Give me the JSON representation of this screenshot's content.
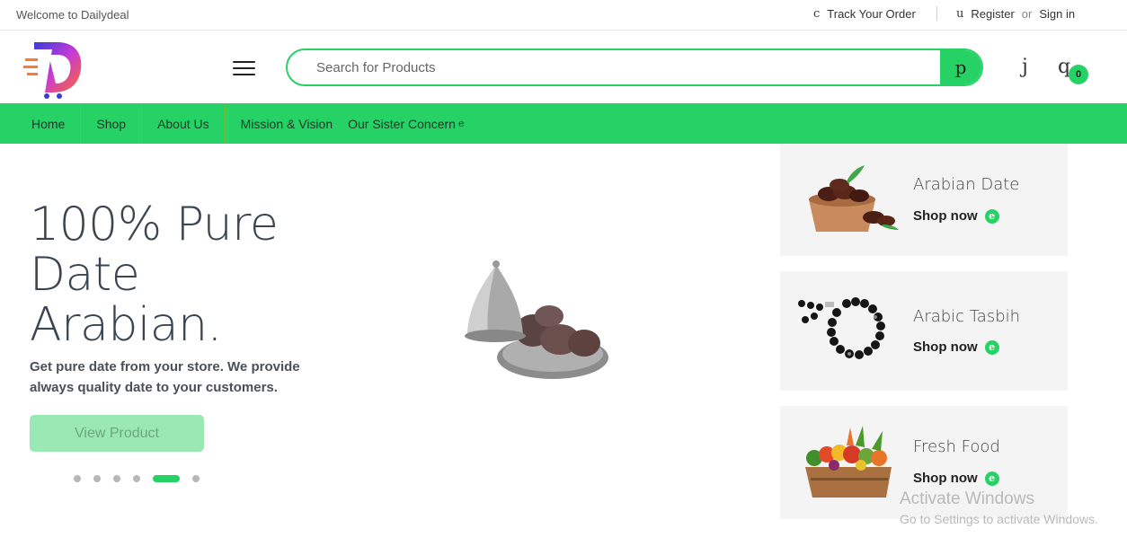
{
  "topbar": {
    "welcome": "Welcome to Dailydeal",
    "track_icon": "c",
    "track_label": "Track Your Order",
    "account_icon": "u",
    "register_label": "Register",
    "or_label": "or",
    "signin_label": "Sign in"
  },
  "header": {
    "search_placeholder": "Search for Products",
    "search_icon": "p",
    "wishlist_icon": "j",
    "cart_icon": "q",
    "cart_count": "0"
  },
  "nav": {
    "items": [
      {
        "label": "Home"
      },
      {
        "label": "Shop"
      },
      {
        "label": "About Us"
      },
      {
        "label": "Mission & Vision"
      },
      {
        "label": "Our Sister Concern",
        "arrow": "e"
      }
    ]
  },
  "hero": {
    "title_lines": [
      "100% Pure",
      "Date",
      "Arabian."
    ],
    "description": "Get pure date from your store. We provide always quality date to your customers.",
    "button_label": "View Product",
    "slides_total": 6,
    "active_slide": 5
  },
  "cards": [
    {
      "title": "Arabian Date",
      "link": "Shop now",
      "link_icon": "e",
      "image": "dates-bowl"
    },
    {
      "title": "Arabic Tasbih",
      "link": "Shop now",
      "link_icon": "e",
      "image": "tasbih-beads"
    },
    {
      "title": "Fresh Food",
      "link": "Shop now",
      "link_icon": "e",
      "image": "vegetable-crate"
    }
  ],
  "watermark": {
    "line1": "Activate Windows",
    "line2": "Go to Settings to activate Windows."
  },
  "colors": {
    "accent": "#26d265",
    "button_disabled": "#9ae8b4",
    "card_bg": "#f4f4f4"
  }
}
